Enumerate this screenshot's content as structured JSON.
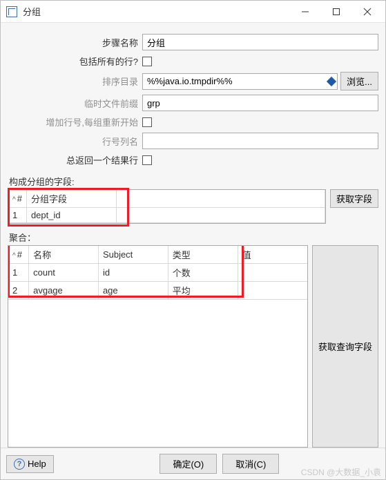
{
  "window": {
    "title": "分组",
    "minimize": "－",
    "maximize": "□",
    "close": "×"
  },
  "form": {
    "step_name_label": "步骤名称",
    "step_name_value": "分组",
    "include_all_label": "包括所有的行?",
    "sort_dir_label": "排序目录",
    "sort_dir_value": "%%java.io.tmpdir%%",
    "browse_label": "浏览...",
    "tmp_prefix_label": "临时文件前缀",
    "tmp_prefix_value": "grp",
    "add_rownum_label": "增加行号,每组重新开始",
    "rownum_col_label": "行号列名",
    "always_one_row_label": "总返回一个结果行"
  },
  "group": {
    "section_label": "构成分组的字段:",
    "get_fields_btn": "获取字段",
    "header_num": "#",
    "header_field": "分组字段",
    "rows": [
      {
        "n": "1",
        "field": "dept_id"
      }
    ]
  },
  "agg": {
    "section_label": "聚合：",
    "get_query_fields_btn": "获取查询字段",
    "header_num": "#",
    "header_name": "名称",
    "header_subject": "Subject",
    "header_type": "类型",
    "header_value": "值",
    "rows": [
      {
        "n": "1",
        "name": "count",
        "subject": "id",
        "type": "个数",
        "value": ""
      },
      {
        "n": "2",
        "name": "avgage",
        "subject": "age",
        "type": "平均",
        "value": ""
      }
    ]
  },
  "footer": {
    "help": "Help",
    "ok": "确定(O)",
    "cancel": "取消(C)"
  },
  "watermark": "CSDN @大数据_小袁"
}
